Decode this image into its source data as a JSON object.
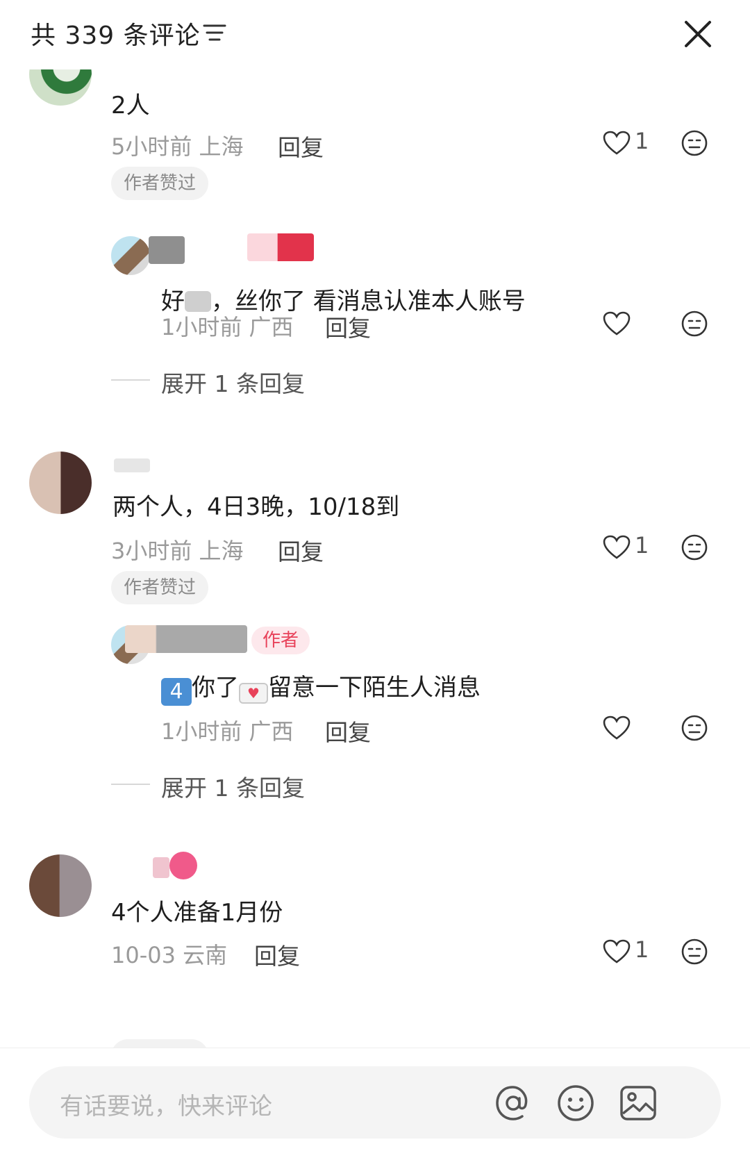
{
  "header": {
    "title": "共 339 条评论"
  },
  "input": {
    "placeholder": "有话要说，快来评论"
  },
  "comments": [
    {
      "text": "2人",
      "time": "5小时前",
      "location": "上海",
      "reply_label": "回复",
      "likes": "1",
      "badge": "作者赞过",
      "reply": {
        "text_prefix": "好",
        "text_suffix": "，丝你了 看消息认准本人账号",
        "time": "1小时前",
        "location": "广西",
        "reply_label": "回复"
      },
      "expand": "展开 1 条回复"
    },
    {
      "text": "两个人，4日3晚，10/18到",
      "time": "3小时前",
      "location": "上海",
      "reply_label": "回复",
      "likes": "1",
      "badge": "作者赞过",
      "reply": {
        "author_tag": "作者",
        "text_a": "你了",
        "text_b": "留意一下陌生人消息",
        "time": "1小时前",
        "location": "广西",
        "reply_label": "回复"
      },
      "expand": "展开 1 条回复"
    },
    {
      "text": "4个人准备1月份",
      "time": "10-03",
      "location": "云南",
      "reply_label": "回复",
      "likes": "1"
    }
  ],
  "icons": {
    "filter": "filter-icon",
    "close": "close-icon",
    "like": "heart-icon",
    "emoji": "emoji-icon",
    "at": "at-icon",
    "smile": "smile-icon",
    "image": "image-icon"
  },
  "colors": {
    "accent": "#e8425a",
    "meta_text": "#9a9a9a",
    "badge_bg": "#f2f2f2"
  }
}
